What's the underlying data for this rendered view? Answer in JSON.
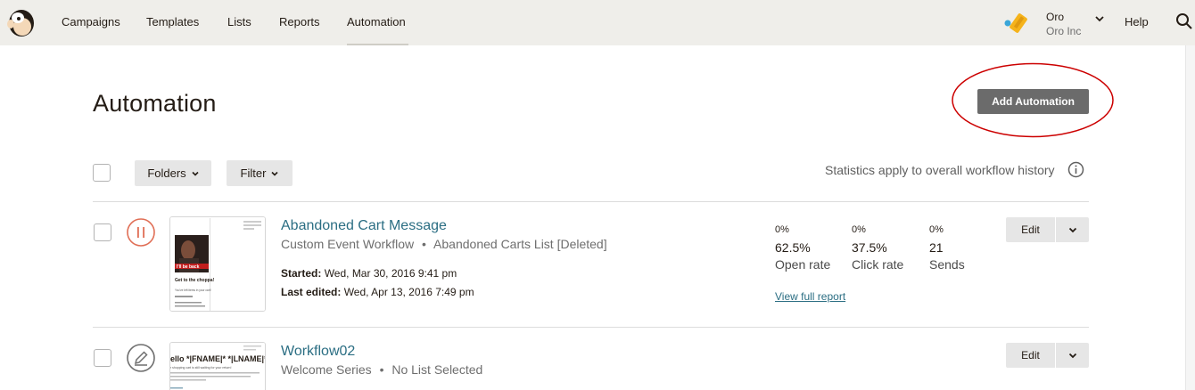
{
  "nav": {
    "items": [
      "Campaigns",
      "Templates",
      "Lists",
      "Reports",
      "Automation"
    ],
    "active": "Automation",
    "user_name": "Oro",
    "user_org": "Oro Inc",
    "help": "Help"
  },
  "page": {
    "title": "Automation",
    "add_button": "Add Automation"
  },
  "toolbar": {
    "folders": "Folders",
    "filter": "Filter",
    "stats_note": "Statistics apply to overall workflow history"
  },
  "workflows": [
    {
      "title": "Abandoned Cart Message",
      "type": "Custom Event Workflow",
      "list": "Abandoned Carts List [Deleted]",
      "status": "paused",
      "started_label": "Started:",
      "started": "Wed, Mar 30, 2016 9:41 pm",
      "edited_label": "Last edited:",
      "edited": "Wed, Apr 13, 2016 7:49 pm",
      "stats": [
        {
          "pct": "0%",
          "value": "62.5%",
          "label": "Open rate"
        },
        {
          "pct": "0%",
          "value": "37.5%",
          "label": "Click rate"
        },
        {
          "pct": "0%",
          "value": "21",
          "label": "Sends"
        }
      ],
      "report_link": "View full report",
      "thumb": {
        "banner": "I'll be back",
        "heading": "Get to the choppa!",
        "line1": "You've left items in your cart!"
      },
      "edit": "Edit"
    },
    {
      "title": "Workflow02",
      "type": "Welcome Series",
      "list": "No List Selected",
      "status": "draft",
      "thumb": {
        "heading": "ello *|FNAME|* *|LNAME|*!",
        "line1": "r shopping cart is still waiting for your return!"
      },
      "edit": "Edit"
    }
  ],
  "separator": "•",
  "colors": {
    "nav_bg": "#efeeea",
    "link": "#2b6e83",
    "paused": "#e06e55",
    "annotation": "#cc0000"
  }
}
